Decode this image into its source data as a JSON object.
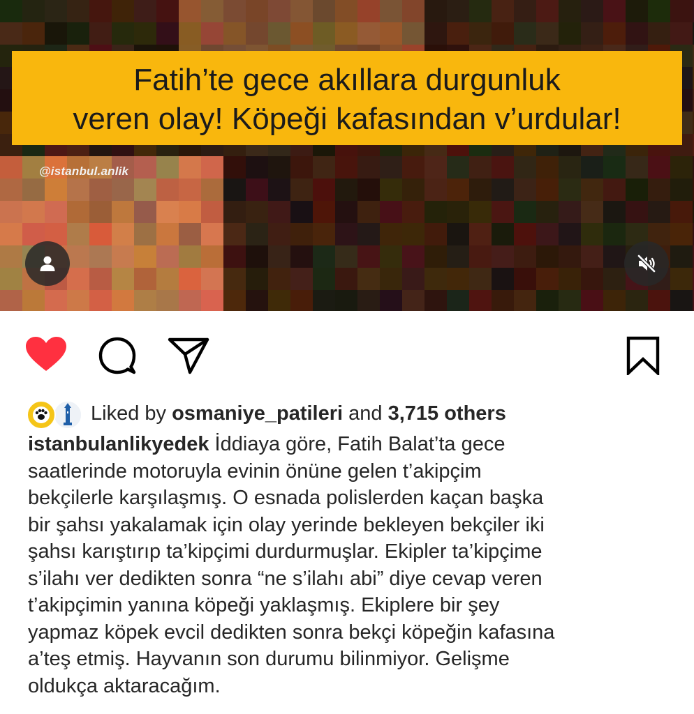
{
  "media": {
    "headline_line_1": "Fatih’te gece akıllara durgunluk",
    "headline_line_2": "veren olay! Köpeği kafasından v’urdular!",
    "watermark": "@istanbul.anlik",
    "headline_bg_color": "#f9b70d",
    "tagged_users_icon": "person-icon",
    "mute_icon": "speaker-muted-icon"
  },
  "actions": {
    "like_icon": "heart-filled-icon",
    "like_color": "#ff3040",
    "comment_icon": "comment-icon",
    "share_icon": "paper-plane-icon",
    "save_icon": "bookmark-icon"
  },
  "likes": {
    "prefix": "Liked by",
    "user": "osmaniye_patileri",
    "middle": "and",
    "count": "3,715 others"
  },
  "caption": {
    "username": "istanbulanlikyedek",
    "lines": [
      " İddiaya göre, Fatih Balat’ta gece",
      "saatlerinde motoruyla evinin önüne gelen t’akipçim",
      "bekçilerle karşılaşmış. O esnada polislerden kaçan başka",
      "bir şahsı yakalamak için olay yerinde bekleyen bekçiler iki",
      "şahsı karıştırıp ta’kipçimi durdurmuşlar. Ekipler ta’kipçime",
      "s’ilahı ver dedikten sonra “ne s’ilahı abi” diye cevap veren",
      "t’akipçimin yanına köpeği yaklaşmış. Ekiplere bir şey",
      "yapmaz köpek evcil dedikten sonra bekçi köpeğin kafasına",
      "a’teş etmiş. Hayvanın son durumu bilinmiyor. Gelişme",
      "oldukça aktaracağım."
    ]
  }
}
